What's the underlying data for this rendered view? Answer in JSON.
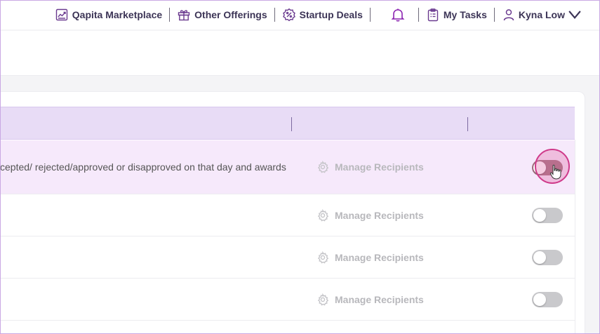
{
  "nav": {
    "marketplace": "Qapita Marketplace",
    "offerings": "Other Offerings",
    "deals": "Startup Deals",
    "tasks": "My Tasks",
    "user": "Kyna Low"
  },
  "icons": {
    "marketplace": "chart-icon",
    "offerings": "gift-icon",
    "deals": "percent-badge-icon",
    "notifications": "bell-icon",
    "tasks": "clipboard-icon",
    "user": "user-icon",
    "dropdown": "chevron-down-icon",
    "manage": "gear-icon"
  },
  "colors": {
    "accent": "#7a2ea0",
    "header_bg": "#e8dcf6",
    "highlight_row": "#f6e9fb",
    "toggle_off": "#c9c9cc",
    "click_indicator": "#cf3a8a"
  },
  "table": {
    "rows": [
      {
        "description": "cepted/ rejected/approved or disapproved on that day and awards",
        "action": "Manage Recipients",
        "toggle_on": true
      },
      {
        "description": "",
        "action": "Manage Recipients",
        "toggle_on": false
      },
      {
        "description": "",
        "action": "Manage Recipients",
        "toggle_on": false
      },
      {
        "description": "",
        "action": "Manage Recipients",
        "toggle_on": false
      }
    ]
  }
}
